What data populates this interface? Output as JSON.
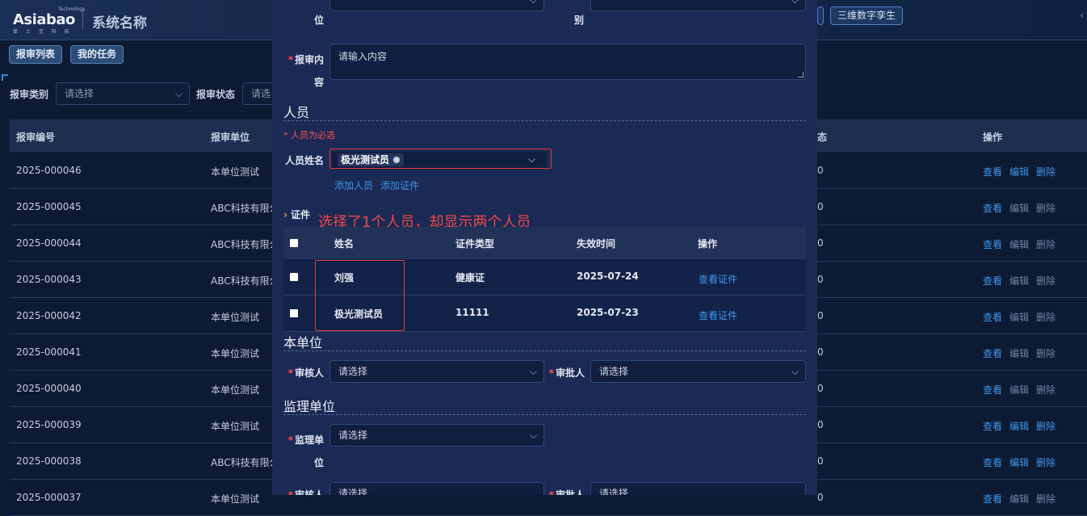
{
  "app": {
    "logo_text": "Asiabao",
    "logo_top": "Technology",
    "logo_sub": "爱 士 宝 科 技",
    "system_name": "系统名称"
  },
  "topbar": {
    "buttons": [
      "三维数字孪生"
    ]
  },
  "tabs": [
    "报审列表",
    "我的任务"
  ],
  "filters": {
    "category_label": "报审类别",
    "category_placeholder": "请选择",
    "status_label": "报审状态",
    "status_placeholder": "请选"
  },
  "table": {
    "columns": [
      "报审编号",
      "报审单位",
      "态",
      "操作"
    ],
    "rows": [
      {
        "id": "2025-000046",
        "unit": "本单位测试",
        "mark": "0"
      },
      {
        "id": "2025-000045",
        "unit": "ABC科技有限公",
        "mark": "0"
      },
      {
        "id": "2025-000044",
        "unit": "ABC科技有限公",
        "mark": "0"
      },
      {
        "id": "2025-000043",
        "unit": "ABC科技有限公",
        "mark": "0"
      },
      {
        "id": "2025-000042",
        "unit": "本单位测试",
        "mark": "0"
      },
      {
        "id": "2025-000041",
        "unit": "本单位测试",
        "mark": "0"
      },
      {
        "id": "2025-000040",
        "unit": "本单位测试",
        "mark": "0"
      },
      {
        "id": "2025-000039",
        "unit": "本单位测试",
        "mark": "0"
      },
      {
        "id": "2025-000038",
        "unit": "ABC科技有限公",
        "mark": "0"
      },
      {
        "id": "2025-000037",
        "unit": "本单位测试",
        "mark": "0"
      }
    ],
    "actions": {
      "view": "查看",
      "edit": "编辑",
      "delete": "删除"
    }
  },
  "modal": {
    "top_label_left": "位",
    "top_label_right": "别",
    "content_label": "报审内容",
    "content_placeholder": "请输入内容",
    "personnel_section": "人员",
    "personnel_required_hint": "* 人员为必选",
    "person_name_label": "人员姓名",
    "person_tag": "极光测试员",
    "add_person": "添加人员",
    "add_cert": "添加证件",
    "cert_label": "证件",
    "annotation": "选择了1个人员，却显示两个人员",
    "cert_table": {
      "columns": [
        "姓名",
        "证件类型",
        "失效时间",
        "操作"
      ],
      "rows": [
        {
          "name": "刘强",
          "type": "健康证",
          "expiry": "2025-07-24",
          "action": "查看证件"
        },
        {
          "name": "极光测试员",
          "type": "11111",
          "expiry": "2025-07-23",
          "action": "查看证件"
        }
      ]
    },
    "own_unit_section": "本单位",
    "reviewer_label": "审核人",
    "approver_label": "审批人",
    "select_placeholder": "请选择",
    "supervisor_section": "监理单位",
    "supervisor_unit_label": "监理单位"
  },
  "colors": {
    "accent": "#3f96e8",
    "required": "#ff4d4f",
    "highlight_box": "#e23b3b"
  }
}
